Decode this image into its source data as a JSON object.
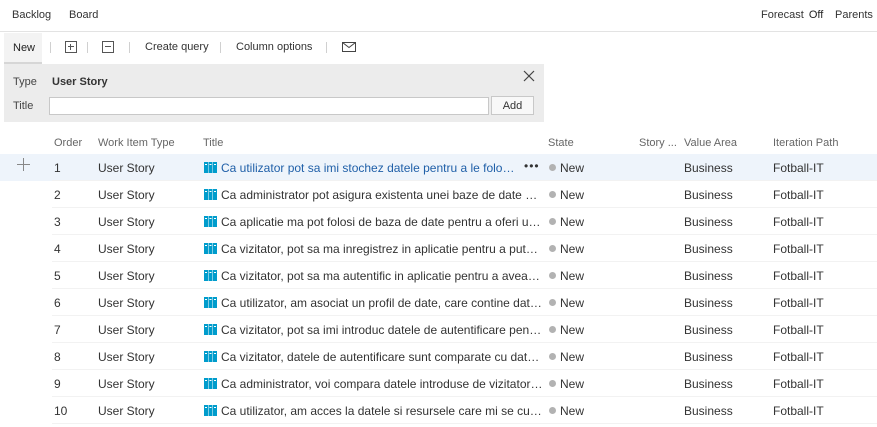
{
  "tabs": {
    "backlog": "Backlog",
    "board": "Board"
  },
  "view_options": {
    "forecast_label": "Forecast",
    "forecast_state": "Off",
    "parents_label": "Parents"
  },
  "toolbar": {
    "new_label": "New",
    "expand_icon": "expand-all-icon",
    "collapse_icon": "collapse-all-icon",
    "create_query_label": "Create query",
    "column_options_label": "Column options",
    "email_icon": "email-icon"
  },
  "add_panel": {
    "type_label": "Type",
    "type_value": "User Story",
    "title_label": "Title",
    "title_value": "",
    "add_label": "Add",
    "close_icon": "close-icon"
  },
  "grid": {
    "columns": [
      "Order",
      "Work Item Type",
      "Title",
      "State",
      "Story ...",
      "Value Area",
      "Iteration Path"
    ],
    "accent_color": "#1f5fa8",
    "icon_color": "#009ccc",
    "rows": [
      {
        "order": "1",
        "type": "User Story",
        "title": "Ca utilizator pot sa imi stochez datele pentru a le folosi ulterior",
        "state": "New",
        "story_points": "",
        "value_area": "Business",
        "iteration": "Fotball-IT",
        "selected": true
      },
      {
        "order": "2",
        "type": "User Story",
        "title": "Ca administrator pot asigura existenta unei baze de date pentru aplicatie",
        "state": "New",
        "story_points": "",
        "value_area": "Business",
        "iteration": "Fotball-IT"
      },
      {
        "order": "3",
        "type": "User Story",
        "title": "Ca aplicatie ma pot folosi de baza de date pentru a oferi un serviciu",
        "state": "New",
        "story_points": "",
        "value_area": "Business",
        "iteration": "Fotball-IT"
      },
      {
        "order": "4",
        "type": "User Story",
        "title": "Ca vizitator, pot sa ma inregistrez in aplicatie pentru a putea accesa",
        "state": "New",
        "story_points": "",
        "value_area": "Business",
        "iteration": "Fotball-IT"
      },
      {
        "order": "5",
        "type": "User Story",
        "title": "Ca vizitator, pot sa ma autentific in aplicatie pentru a avea acces",
        "state": "New",
        "story_points": "",
        "value_area": "Business",
        "iteration": "Fotball-IT"
      },
      {
        "order": "6",
        "type": "User Story",
        "title": "Ca utilizator, am asociat un profil de date, care contine datele mele",
        "state": "New",
        "story_points": "",
        "value_area": "Business",
        "iteration": "Fotball-IT"
      },
      {
        "order": "7",
        "type": "User Story",
        "title": "Ca vizitator, pot sa imi introduc datele de autentificare pentru a intra",
        "state": "New",
        "story_points": "",
        "value_area": "Business",
        "iteration": "Fotball-IT"
      },
      {
        "order": "8",
        "type": "User Story",
        "title": "Ca vizitator, datele de autentificare sunt comparate cu datele existente",
        "state": "New",
        "story_points": "",
        "value_area": "Business",
        "iteration": "Fotball-IT"
      },
      {
        "order": "9",
        "type": "User Story",
        "title": "Ca administrator, voi compara datele introduse de vizitator pentru validare",
        "state": "New",
        "story_points": "",
        "value_area": "Business",
        "iteration": "Fotball-IT"
      },
      {
        "order": "10",
        "type": "User Story",
        "title": "Ca utilizator, am acces la datele si resursele care mi se cuvin, conform rolului",
        "state": "New",
        "story_points": "",
        "value_area": "Business",
        "iteration": "Fotball-IT"
      }
    ]
  }
}
